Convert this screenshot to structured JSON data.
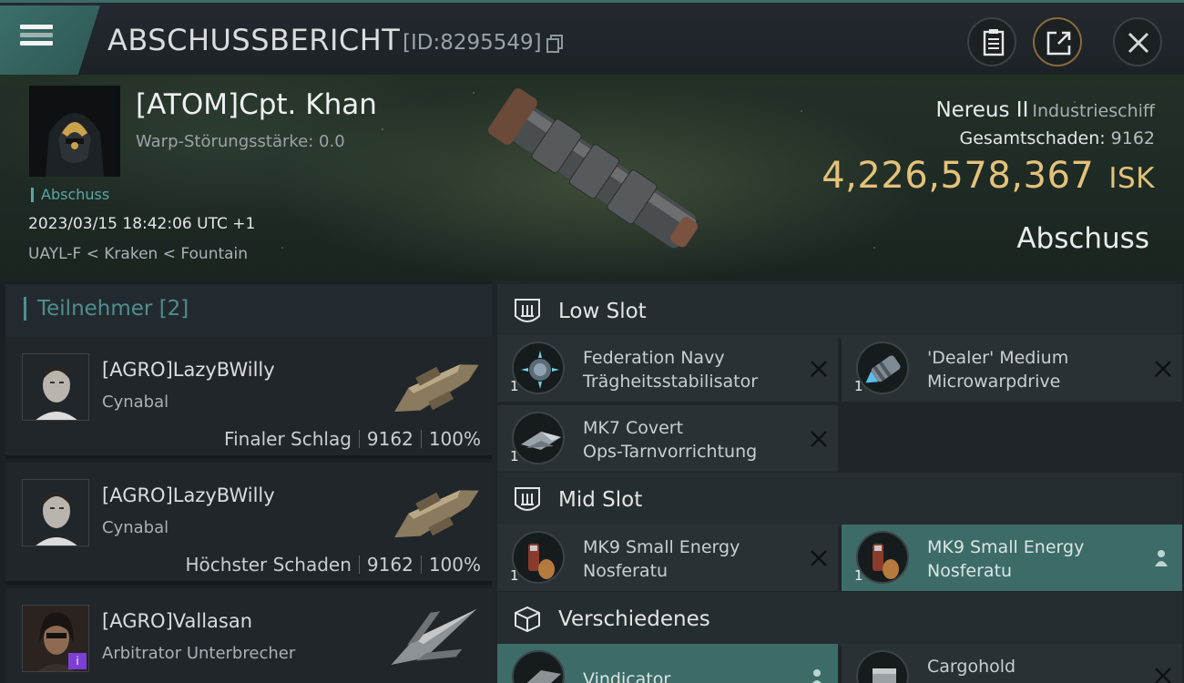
{
  "header": {
    "title": "ABSCHUSSBERICHT",
    "report_id": "[ID:8295549]"
  },
  "victim": {
    "name": "[ATOM]Cpt. Khan",
    "warp_strength": "Warp-Störungsstärke: 0.0",
    "tag": "Abschuss",
    "datetime": "2023/03/15 18:42:06 UTC +1",
    "location": "UAYL-F < Kraken < Fountain",
    "ship_name": "Nereus II",
    "ship_class": "Industrieschiff",
    "damage_label": "Gesamtschaden:",
    "damage_value": "9162",
    "isk_value": "4,226,578,367",
    "isk_unit": "ISK",
    "result": "Abschuss"
  },
  "participants": {
    "header": "Teilnehmer [2]",
    "items": [
      {
        "name": "[AGRO]LazyBWilly",
        "ship": "Cynabal",
        "role": "Finaler Schlag",
        "damage": "9162",
        "percent": "100%"
      },
      {
        "name": "[AGRO]LazyBWilly",
        "ship": "Cynabal",
        "role": "Höchster Schaden",
        "damage": "9162",
        "percent": "100%"
      },
      {
        "name": "[AGRO]Vallasan",
        "ship": "Arbitrator Unterbrecher",
        "role": "",
        "damage": "",
        "percent": ""
      }
    ]
  },
  "fitting": {
    "low_slot": {
      "label": "Low Slot",
      "items": [
        {
          "qty": "1",
          "name_line1": "Federation Navy",
          "name_line2": "Trägheitsstabilisator"
        },
        {
          "qty": "1",
          "name_line1": "'Dealer' Medium",
          "name_line2": "Microwarpdrive"
        },
        {
          "qty": "1",
          "name_line1": "MK7 Covert",
          "name_line2": "Ops-Tarnvorrichtung"
        }
      ]
    },
    "mid_slot": {
      "label": "Mid Slot",
      "items": [
        {
          "qty": "1",
          "name_line1": "MK9 Small Energy",
          "name_line2": "Nosferatu"
        },
        {
          "qty": "1",
          "name_line1": "MK9 Small Energy",
          "name_line2": "Nosferatu"
        }
      ]
    },
    "misc": {
      "label": "Verschiedenes",
      "items": [
        {
          "name_line1": "Vindicator"
        },
        {
          "name_line1": "Cargohold"
        }
      ]
    }
  },
  "colors": {
    "accent_teal": "#3d6b67",
    "isk_gold": "#e4c27a",
    "label_teal": "#4e8f8f"
  }
}
